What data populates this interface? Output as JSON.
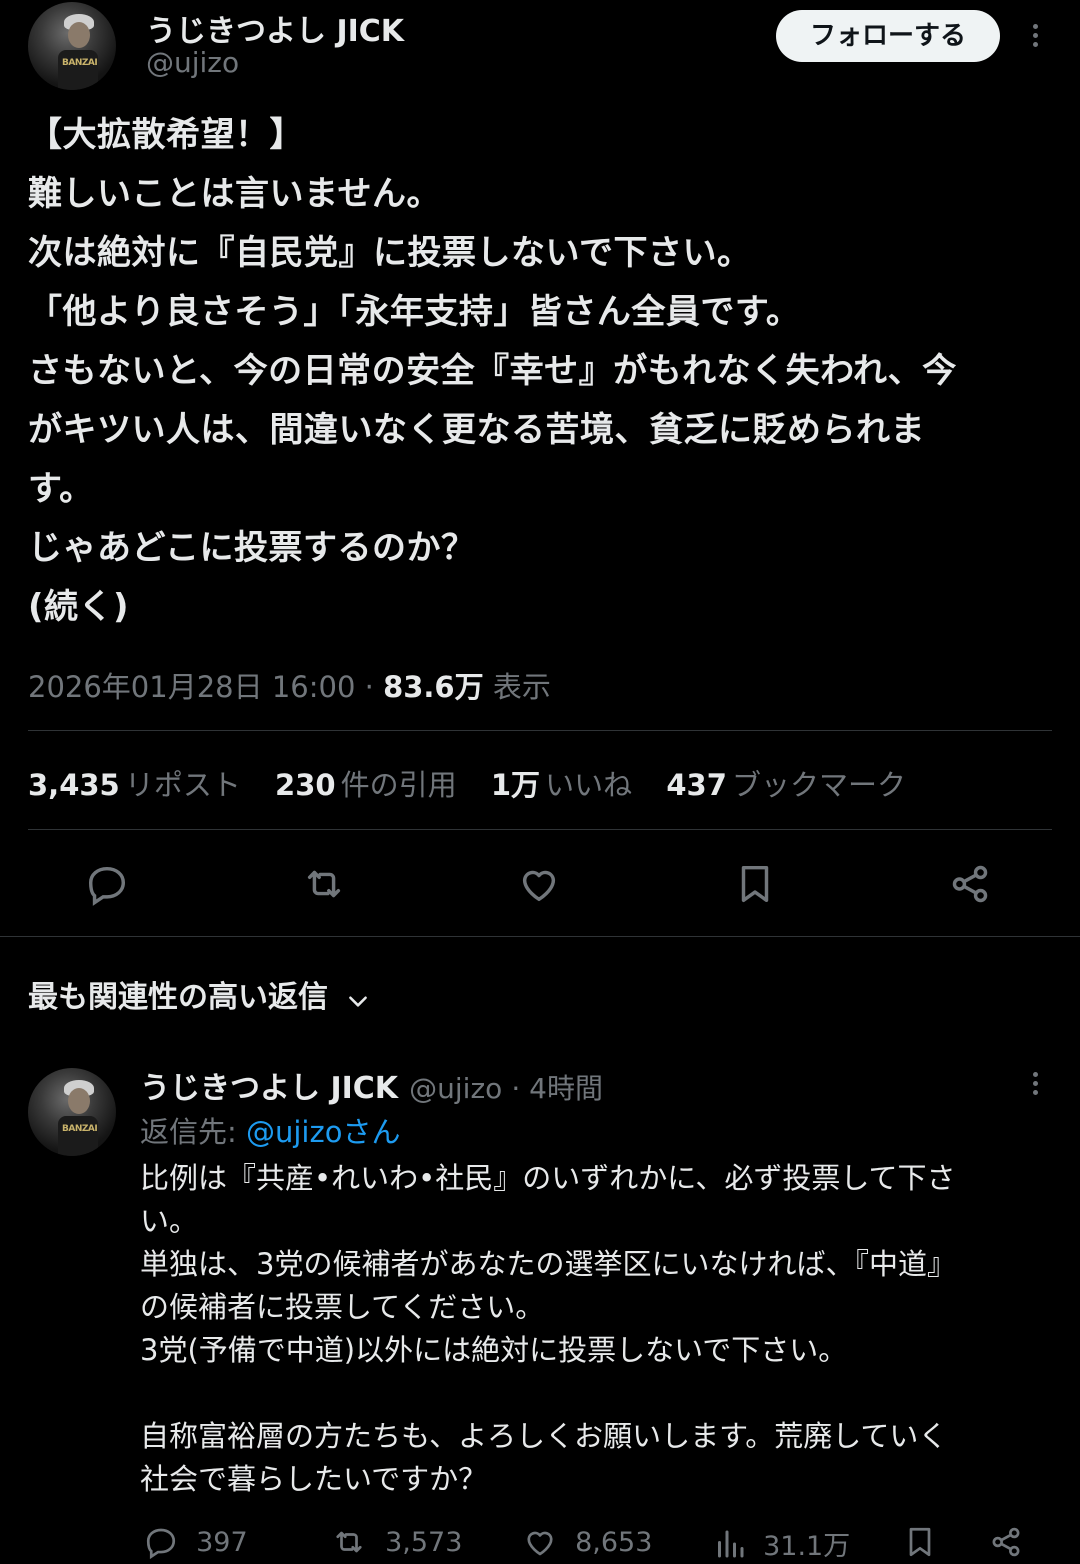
{
  "tweet": {
    "display_name": "うじきつよし JICK",
    "handle": "@ujizo",
    "follow_label": "フォローする",
    "text": "【大拡散希望！】\n難しいことは言いません。\n次は絶対に『自民党』に投票しないで下さい。\n「他より良さそう」「永年支持」皆さん全員です。\nさもないと、今の日常の安全『幸せ』がもれなく失われ、今\nがキツい人は、間違いなく更なる苦境、貧乏に貶められま\nす。\nじゃあどこに投票するのか？\n(続く)",
    "timestamp": "2026年01月28日 16:00",
    "separator": " · ",
    "views": "83.6万",
    "views_label": "表示",
    "stats": [
      {
        "num": "3,435",
        "label": "リポスト"
      },
      {
        "num": "230",
        "label": "件の引用"
      },
      {
        "num": "1万",
        "label": "いいね"
      },
      {
        "num": "437",
        "label": "ブックマーク"
      }
    ],
    "actions": [
      "reply-icon",
      "repost-icon",
      "like-icon",
      "bookmark-icon",
      "share-icon"
    ]
  },
  "replies_header": {
    "label": "最も関連性の高い返信",
    "icon": "chevron-down-icon"
  },
  "reply": {
    "display_name": "うじきつよし JICK",
    "handle": "@ujizo",
    "time": "· 4時間",
    "reply_to_prefix": "返信先: ",
    "reply_to_link": "@ujizoさん",
    "text": "比例は『共産•れいわ•社民』のいずれかに、必ず投票して下さ\nい。\n単独は、3党の候補者があなたの選挙区にいなければ、『中道』\nの候補者に投票してください。\n3党(予備で中道)以外には絶対に投票しないで下さい。\n\n自称富裕層の方たちも、よろしくお願いします。荒廃していく\n社会で暮らしたいですか？",
    "counts": {
      "replies": "397",
      "reposts": "3,573",
      "likes": "8,653",
      "views": "31.1万"
    }
  },
  "colors": {
    "background": "#000000",
    "text": "#e7e9ea",
    "secondary": "#71767b",
    "link": "#1d9bf0",
    "divider": "#2f3336"
  }
}
